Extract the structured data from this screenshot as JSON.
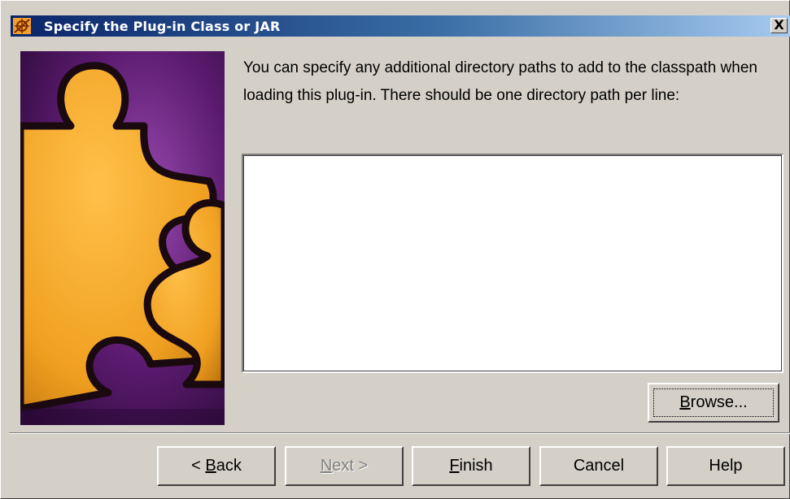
{
  "window": {
    "title": "Specify the Plug-in Class or JAR",
    "close_label": "X"
  },
  "content": {
    "description": "You can specify any additional directory paths to add to the classpath when loading this plug-in.  There should be one directory path per line:",
    "paths_value": "",
    "side_image": "puzzle-pieces-image"
  },
  "buttons": {
    "browse": {
      "mnemonic": "B",
      "rest": "rowse..."
    },
    "back": {
      "prefix": "< ",
      "mnemonic": "B",
      "rest": "ack"
    },
    "next": {
      "mnemonic": "N",
      "rest": "ext >"
    },
    "finish": {
      "mnemonic": "F",
      "rest": "inish"
    },
    "cancel": {
      "label": "Cancel"
    },
    "help": {
      "label": "Help"
    }
  },
  "colors": {
    "dialog_bg": "#d4d0c8",
    "title_gradient_start": "#0a246a",
    "title_gradient_end": "#a6caf0",
    "puzzle_orange": "#f5a623",
    "puzzle_purple": "#5a1a6e"
  }
}
